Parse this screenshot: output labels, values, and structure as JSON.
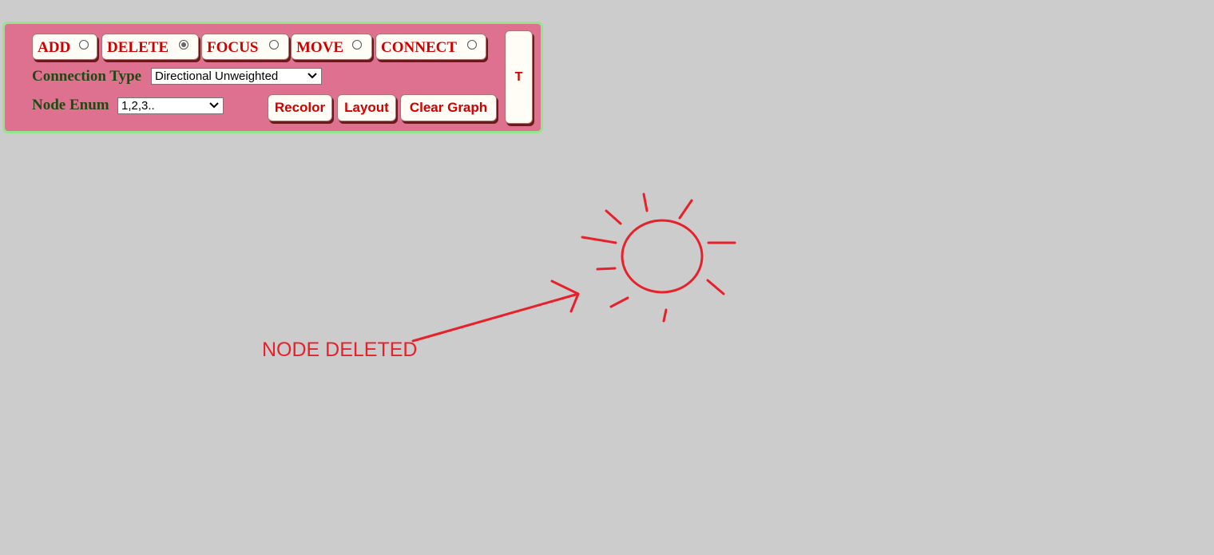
{
  "toolbar": {
    "modes": [
      {
        "label": "ADD",
        "checked": false
      },
      {
        "label": "DELETE",
        "checked": true
      },
      {
        "label": "FOCUS",
        "checked": false
      },
      {
        "label": "MOVE",
        "checked": false
      },
      {
        "label": "CONNECT",
        "checked": false
      }
    ],
    "connection_type": {
      "label": "Connection Type",
      "value": "Directional Unweighted"
    },
    "node_enum": {
      "label": "Node Enum",
      "value": "1,2,3.."
    },
    "actions": {
      "recolor": "Recolor",
      "layout": "Layout",
      "clear_graph": "Clear Graph"
    },
    "toggle_label": "T"
  },
  "annotation": {
    "text": "NODE DELETED",
    "color": "#e8202a",
    "icon": "deleted-node-burst-icon"
  },
  "colors": {
    "canvas_bg": "#cccccc",
    "panel_bg": "#df7190",
    "panel_border": "#93e58d",
    "button_text": "#d10000",
    "label_text": "#1e4a12"
  }
}
